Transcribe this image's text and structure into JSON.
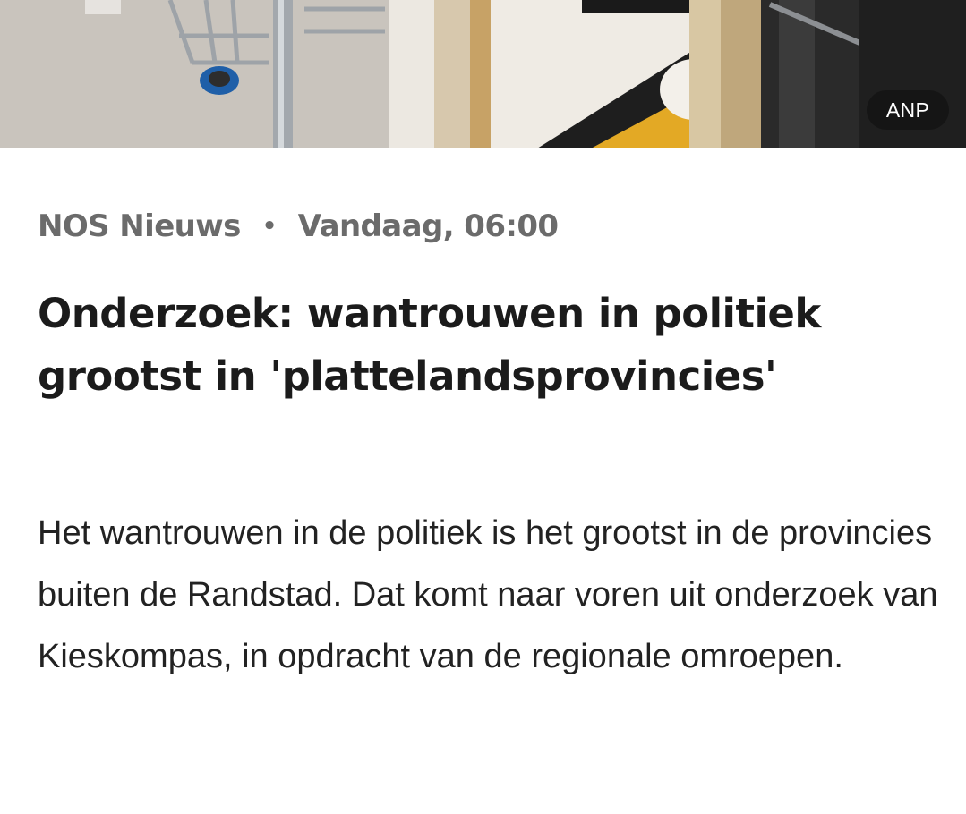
{
  "hero_image": {
    "credit": "ANP",
    "alt_icon": "photo-image"
  },
  "article": {
    "source": "NOS Nieuws",
    "separator": "•",
    "timestamp": "Vandaag, 06:00",
    "headline": "Onderzoek: wantrouwen in politiek grootst in 'plattelandsprovincies'",
    "lead": "Het wantrouwen in de politiek is het grootst in de provincies buiten de Randstad. Dat komt naar voren uit onderzoek van Kieskompas, in opdracht van de regionale omroepen."
  },
  "colors": {
    "meta_text": "#6b6b6b",
    "headline_text": "#1b1b1b",
    "body_text": "#222222",
    "credit_bg": "#141414"
  }
}
